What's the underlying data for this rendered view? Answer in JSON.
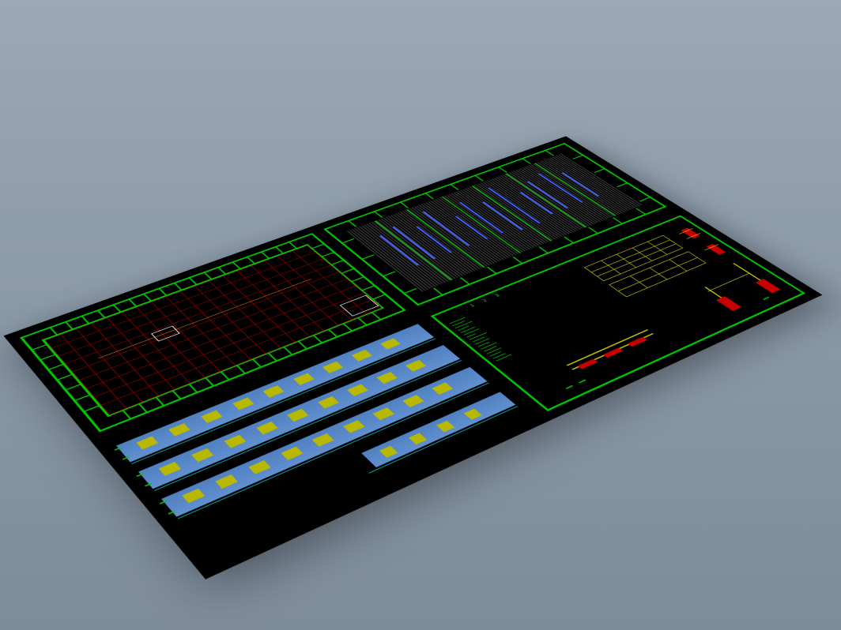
{
  "viewport": {
    "type": "3d-isometric-view",
    "content": "architectural-drawing-sheet"
  },
  "drawing": {
    "quadrants": {
      "top_left": {
        "type": "floor-plan",
        "border_color": "#00c800",
        "grid_color": "#8b0000",
        "grid_rows": 10,
        "grid_cols": 18
      },
      "top_right": {
        "type": "roof-framing-plan",
        "border_color": "#00c800",
        "hatching": "vertical-lines"
      },
      "bottom_left": {
        "type": "building-elevations",
        "elevation_count": 4,
        "wall_color": "#6090d0",
        "window_color": "#b8b800"
      },
      "bottom_right": {
        "type": "construction-details",
        "detail_numbers": [
          "1",
          "2",
          "3"
        ],
        "notes_present": true
      }
    }
  },
  "colors": {
    "background": "#9ba8b5",
    "sheet": "#000000",
    "primary_lines": "#00c800",
    "grid": "#8b0000",
    "elevation": "#6090d0",
    "detail_primary": "#c8c800",
    "detail_accent": "#c80000"
  }
}
